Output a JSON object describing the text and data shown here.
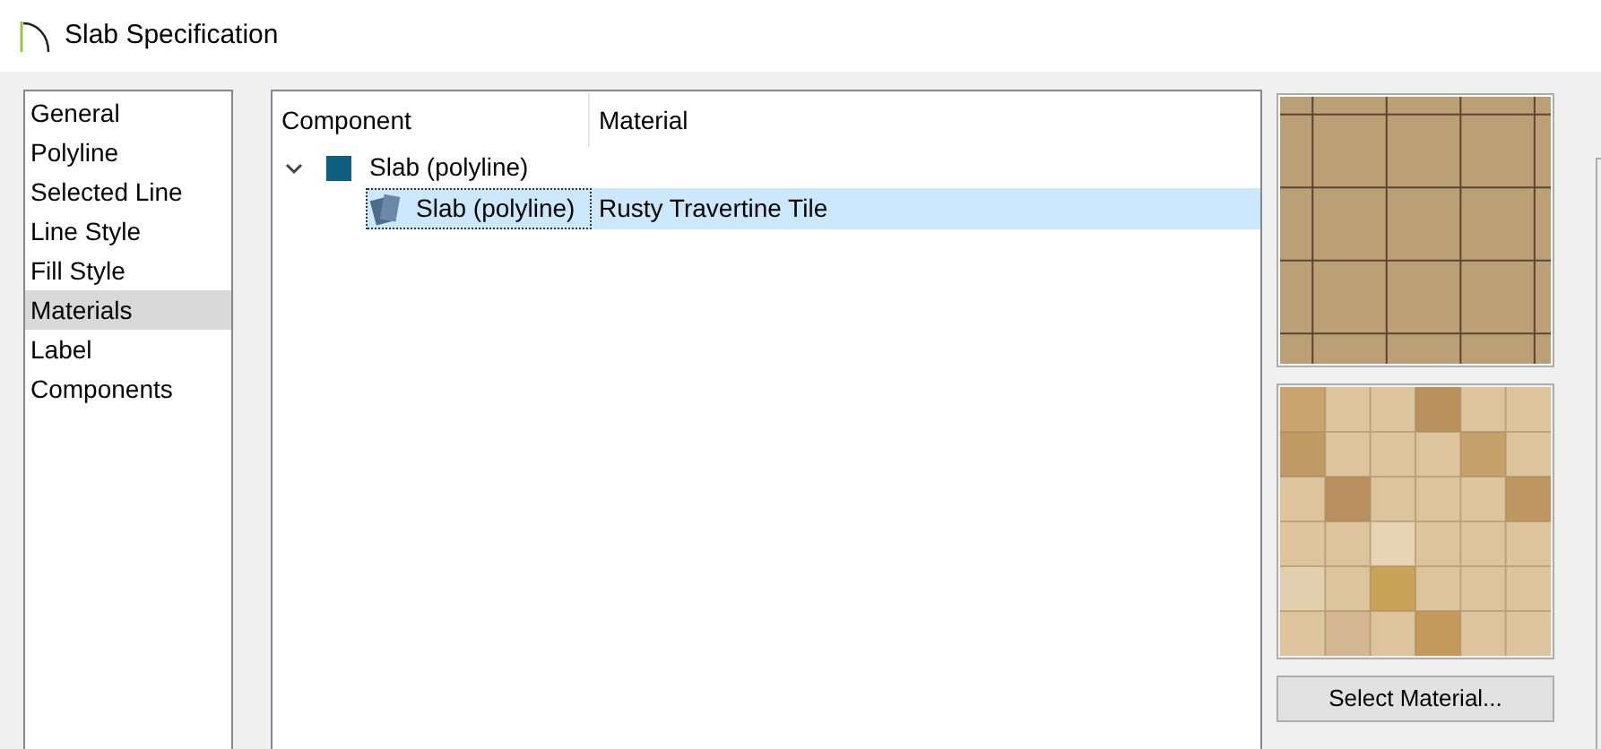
{
  "window": {
    "title": "Slab Specification"
  },
  "sidebar": {
    "items": [
      {
        "label": "General",
        "selected": false
      },
      {
        "label": "Polyline",
        "selected": false
      },
      {
        "label": "Selected Line",
        "selected": false
      },
      {
        "label": "Line Style",
        "selected": false
      },
      {
        "label": "Fill Style",
        "selected": false
      },
      {
        "label": "Materials",
        "selected": true
      },
      {
        "label": "Label",
        "selected": false
      },
      {
        "label": "Components",
        "selected": false
      }
    ]
  },
  "tree": {
    "columns": [
      "Component",
      "Material"
    ],
    "rows": [
      {
        "component": "Slab (polyline)",
        "expanded": true,
        "selected": false,
        "children": [
          {
            "component": "Slab (polyline)",
            "material": "Rusty Travertine Tile",
            "selected": true
          }
        ]
      }
    ]
  },
  "preview": {
    "button": "Select Material..."
  }
}
